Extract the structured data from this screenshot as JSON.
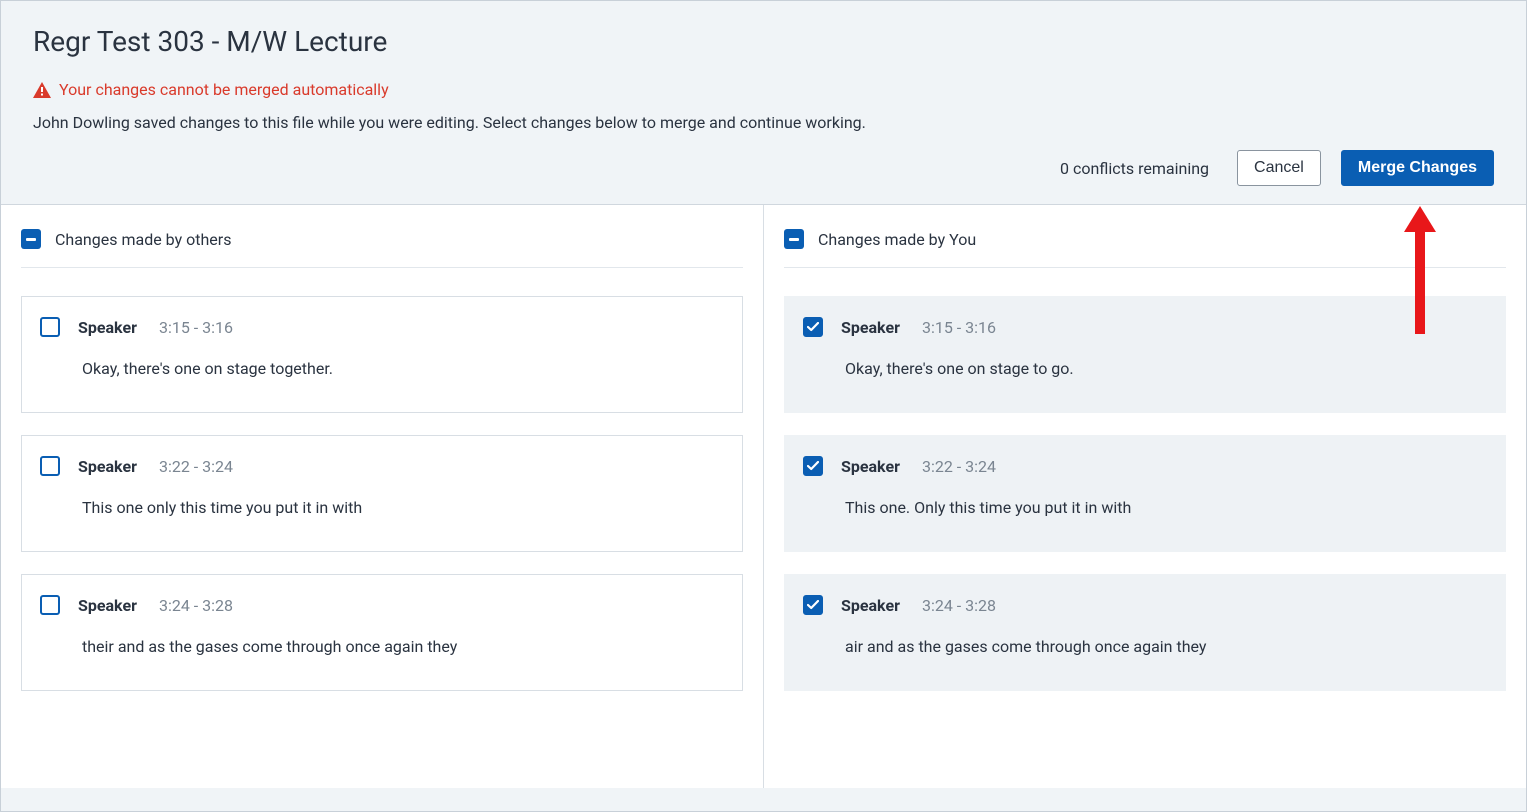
{
  "header": {
    "title": "Regr Test 303 - M/W Lecture",
    "warning": "Your changes cannot be merged automatically",
    "info": "John Dowling saved changes to this file while you were editing. Select changes below to merge and continue working.",
    "conflicts_text": "0 conflicts remaining",
    "cancel_label": "Cancel",
    "merge_label": "Merge Changes"
  },
  "columns": {
    "others": {
      "title": "Changes made by others",
      "items": [
        {
          "speaker": "Speaker",
          "time": "3:15 - 3:16",
          "text": "Okay, there's one on stage together.",
          "checked": false
        },
        {
          "speaker": "Speaker",
          "time": "3:22 - 3:24",
          "text": "This one only this time you put it in with",
          "checked": false
        },
        {
          "speaker": "Speaker",
          "time": "3:24 - 3:28",
          "text": "their and as the gases come through once again they",
          "checked": false
        }
      ]
    },
    "you": {
      "title": "Changes made by You",
      "items": [
        {
          "speaker": "Speaker",
          "time": "3:15 - 3:16",
          "text": "Okay, there's one on stage to go.",
          "checked": true
        },
        {
          "speaker": "Speaker",
          "time": "3:22 - 3:24",
          "text": "This one. Only this time you put it in with",
          "checked": true
        },
        {
          "speaker": "Speaker",
          "time": "3:24 - 3:28",
          "text": "air and as the gases come through once again they",
          "checked": true
        }
      ]
    }
  }
}
